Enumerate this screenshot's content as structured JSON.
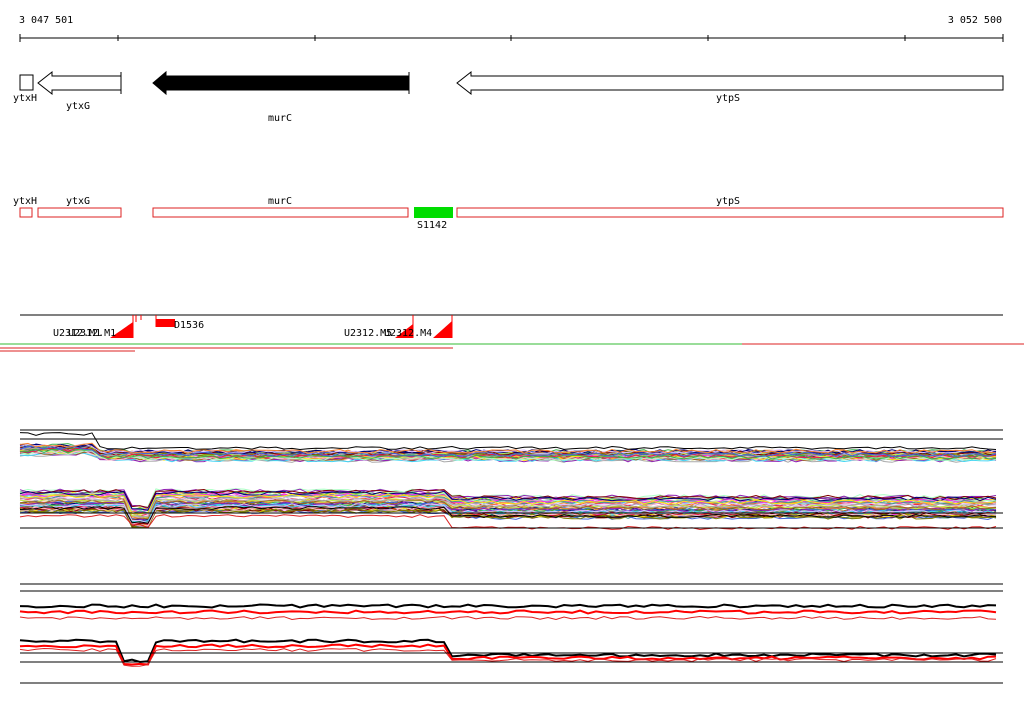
{
  "ruler": {
    "start_label": "3 047 501",
    "end_label": "3 052 500"
  },
  "genes": [
    {
      "name": "ytxH",
      "strand": "box",
      "fill": "#ffffff"
    },
    {
      "name": "ytxG",
      "strand": "-",
      "fill": "#ffffff"
    },
    {
      "name": "murC",
      "strand": "-",
      "fill": "#000000"
    },
    {
      "name": "ytpS",
      "strand": "-",
      "fill": "#ffffff"
    }
  ],
  "features": [
    {
      "name": "ytxH"
    },
    {
      "name": "ytxG"
    },
    {
      "name": "murC"
    },
    {
      "name": "ytpS"
    }
  ],
  "highlight": {
    "name": "S1142",
    "color": "#00dd00"
  },
  "tss_labels": [
    "U2312.M1",
    "U2312.M1",
    "D1536",
    "U2312.M5",
    "U2312.M4"
  ],
  "colors": {
    "feature_outline": "#dd2222",
    "marker": "#ff0000",
    "divider_green": "#33bb33",
    "divider_red": "#dd2222"
  }
}
